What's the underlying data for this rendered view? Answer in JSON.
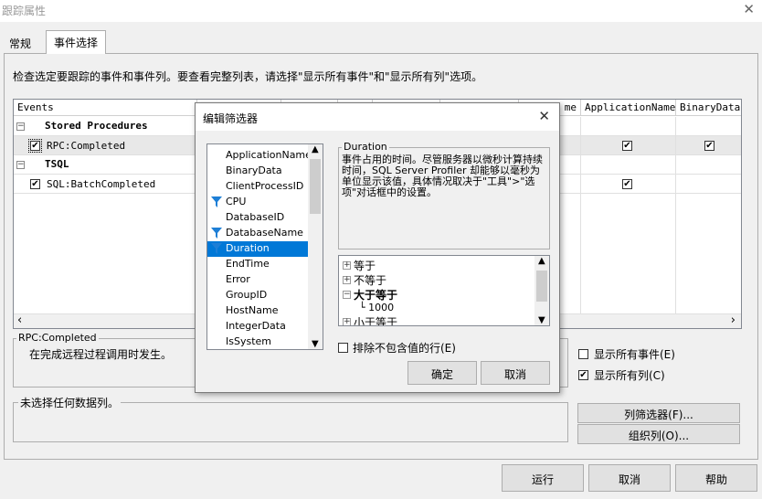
{
  "window": {
    "title": "跟踪属性",
    "close_glyph": "✕"
  },
  "tabs": [
    {
      "label": "常规",
      "selected": false
    },
    {
      "label": "事件选择",
      "selected": true
    }
  ],
  "instructions": "检查选定要跟踪的事件和事件列。要查看完整列表，请选择\"显示所有事件\"和\"显示所有列\"选项。",
  "grid": {
    "columns": [
      "Events",
      "me",
      "ApplicationName",
      "BinaryData"
    ],
    "rows": [
      {
        "type": "category",
        "toggle": "−",
        "label": "Stored Procedures"
      },
      {
        "type": "event",
        "checked": true,
        "label": "RPC:Completed",
        "app_checked": true,
        "bin_checked": true
      },
      {
        "type": "category",
        "toggle": "−",
        "label": "TSQL"
      },
      {
        "type": "event",
        "checked": true,
        "label": "SQL:BatchCompleted",
        "app_checked": true,
        "bin_checked": false
      }
    ],
    "scroll_left": "‹",
    "scroll_right": "›"
  },
  "event_desc": {
    "title": "RPC:Completed",
    "text": "在完成远程过程调用时发生。"
  },
  "column_desc": {
    "text": "未选择任何数据列。"
  },
  "options": {
    "show_all_events": {
      "label": "显示所有事件(E)",
      "checked": false
    },
    "show_all_columns": {
      "label": "显示所有列(C)",
      "checked": true
    }
  },
  "side_buttons": {
    "column_filters": "列筛选器(F)...",
    "organize_columns": "组织列(O)..."
  },
  "footer": {
    "run": "运行",
    "cancel": "取消",
    "help": "帮助"
  },
  "modal": {
    "title": "编辑筛选器",
    "close_glyph": "✕",
    "columns": [
      {
        "name": "ApplicationName",
        "filtered": false,
        "selected": false
      },
      {
        "name": "BinaryData",
        "filtered": false,
        "selected": false
      },
      {
        "name": "ClientProcessID",
        "filtered": false,
        "selected": false
      },
      {
        "name": "CPU",
        "filtered": true,
        "selected": false
      },
      {
        "name": "DatabaseID",
        "filtered": false,
        "selected": false
      },
      {
        "name": "DatabaseName",
        "filtered": true,
        "selected": false
      },
      {
        "name": "Duration",
        "filtered": true,
        "selected": true
      },
      {
        "name": "EndTime",
        "filtered": false,
        "selected": false
      },
      {
        "name": "Error",
        "filtered": false,
        "selected": false
      },
      {
        "name": "GroupID",
        "filtered": false,
        "selected": false
      },
      {
        "name": "HostName",
        "filtered": false,
        "selected": false
      },
      {
        "name": "IntegerData",
        "filtered": false,
        "selected": false
      },
      {
        "name": "IsSystem",
        "filtered": false,
        "selected": false
      }
    ],
    "desc_title": "Duration",
    "desc_text": "事件占用的时间。尽管服务器以微秒计算持续时间，SQL Server Profiler 却能够以毫秒为单位显示该值，具体情况取决于\"工具\">\"选项\"对话框中的设置。",
    "tree": [
      {
        "label": "等于",
        "expanded": false,
        "bold": false
      },
      {
        "label": "不等于",
        "expanded": false,
        "bold": false
      },
      {
        "label": "大于等于",
        "expanded": true,
        "bold": true,
        "children": [
          "1000"
        ]
      },
      {
        "label": "小于等于",
        "expanded": false,
        "bold": false
      }
    ],
    "exclude_label": "排除不包含值的行(E)",
    "exclude_checked": false,
    "ok": "确定",
    "cancel": "取消",
    "accent": "#0078d7",
    "filter_icon_color": "#1e7fd6"
  }
}
